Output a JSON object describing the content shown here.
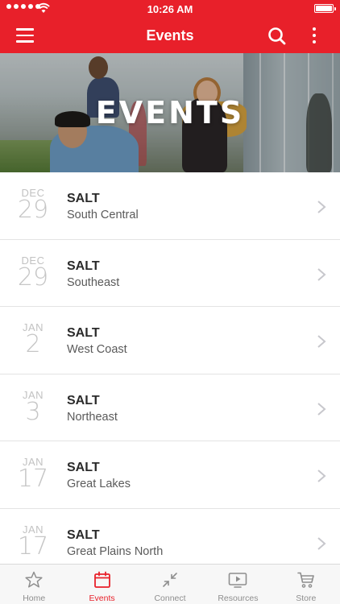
{
  "status_bar": {
    "time": "10:26 AM"
  },
  "nav": {
    "title": "Events"
  },
  "hero": {
    "title": "EVENTS"
  },
  "events": [
    {
      "month": "DEC",
      "day": "29",
      "name": "SALT",
      "region": "South Central"
    },
    {
      "month": "DEC",
      "day": "29",
      "name": "SALT",
      "region": "Southeast"
    },
    {
      "month": "JAN",
      "day": "2",
      "name": "SALT",
      "region": "West Coast"
    },
    {
      "month": "JAN",
      "day": "3",
      "name": "SALT",
      "region": "Northeast"
    },
    {
      "month": "JAN",
      "day": "17",
      "name": "SALT",
      "region": "Great Lakes"
    },
    {
      "month": "JAN",
      "day": "17",
      "name": "SALT",
      "region": "Great Plains North"
    }
  ],
  "tabs": [
    {
      "label": "Home",
      "icon": "star-icon",
      "active": false
    },
    {
      "label": "Events",
      "icon": "calendar-icon",
      "active": true
    },
    {
      "label": "Connect",
      "icon": "collapse-arrows-icon",
      "active": false
    },
    {
      "label": "Resources",
      "icon": "video-play-icon",
      "active": false
    },
    {
      "label": "Store",
      "icon": "cart-icon",
      "active": false
    }
  ],
  "colors": {
    "brand": "#e8202a",
    "inactive_tab": "#8e8e8e"
  }
}
